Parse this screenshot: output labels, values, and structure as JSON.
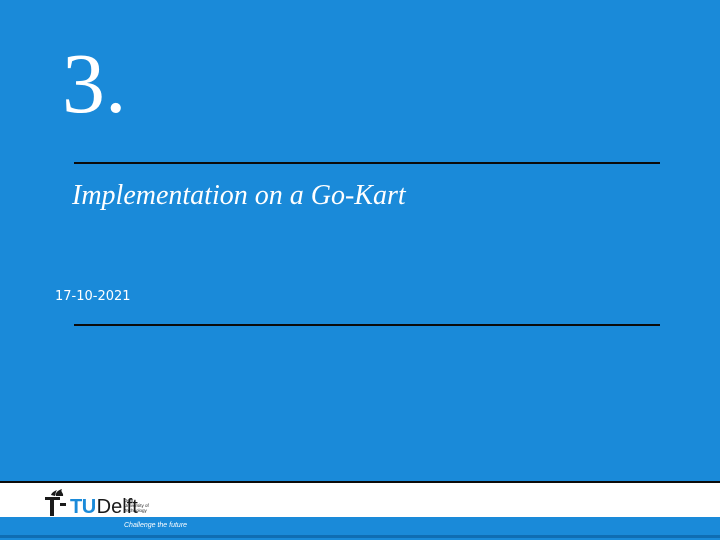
{
  "slide": {
    "section_number": "3.",
    "title": "Implementation on a Go-Kart",
    "date": "17-10-2021"
  },
  "footer": {
    "logo_tu": "TU",
    "logo_delft": "Delft",
    "logo_tag_line1": "Delft",
    "logo_tag_line2": "University of",
    "logo_tag_line3": "Technology",
    "tagline": "Challenge the future"
  },
  "colors": {
    "background": "#1a8ad9",
    "text": "#ffffff",
    "rule": "#0b0b0b",
    "footer_bg": "#ffffff"
  },
  "icons": {
    "logo": "tudelft-flame-icon"
  }
}
